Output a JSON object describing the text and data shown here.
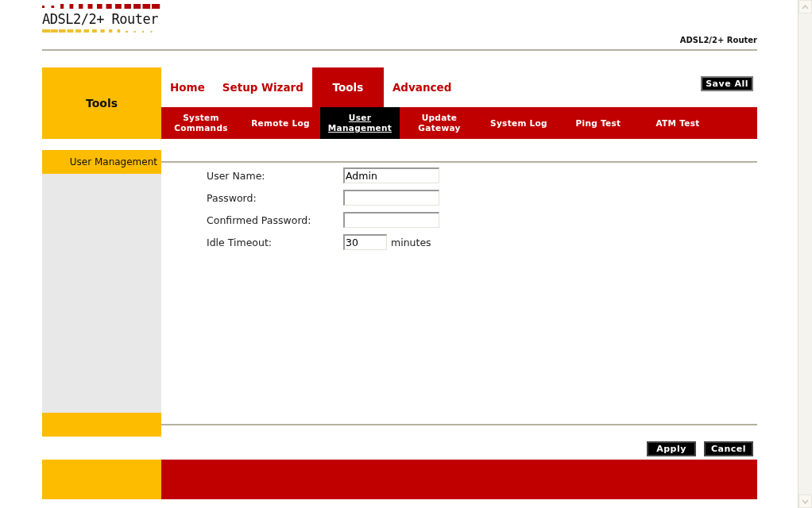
{
  "logo": {
    "text": "ADSL2/2+ Router"
  },
  "header_caption": "ADSL2/2+ Router",
  "section_title": "Tools",
  "main_tabs": [
    {
      "label": "Home",
      "selected": false
    },
    {
      "label": "Setup Wizard",
      "selected": false
    },
    {
      "label": "Tools",
      "selected": true
    },
    {
      "label": "Advanced",
      "selected": false
    }
  ],
  "save_all": "Save All",
  "sub_tabs": [
    {
      "label": "System\nCommands",
      "selected": false
    },
    {
      "label": "Remote Log",
      "selected": false
    },
    {
      "label": "User\nManagement",
      "selected": true
    },
    {
      "label": "Update\nGateway",
      "selected": false
    },
    {
      "label": "System Log",
      "selected": false
    },
    {
      "label": "Ping Test",
      "selected": false
    },
    {
      "label": "ATM Test",
      "selected": false
    }
  ],
  "sidebar": {
    "items": [
      {
        "label": "User Management",
        "selected": true
      }
    ]
  },
  "form": {
    "fields": [
      {
        "kind": "text",
        "label": "User Name:",
        "value": "Admin"
      },
      {
        "kind": "password",
        "label": "Password:"
      },
      {
        "kind": "password",
        "label": "Confirmed Password:"
      },
      {
        "kind": "short",
        "label": "Idle Timeout:",
        "value": "30",
        "unit": "minutes"
      }
    ]
  },
  "buttons": [
    "Apply",
    "Cancel"
  ]
}
